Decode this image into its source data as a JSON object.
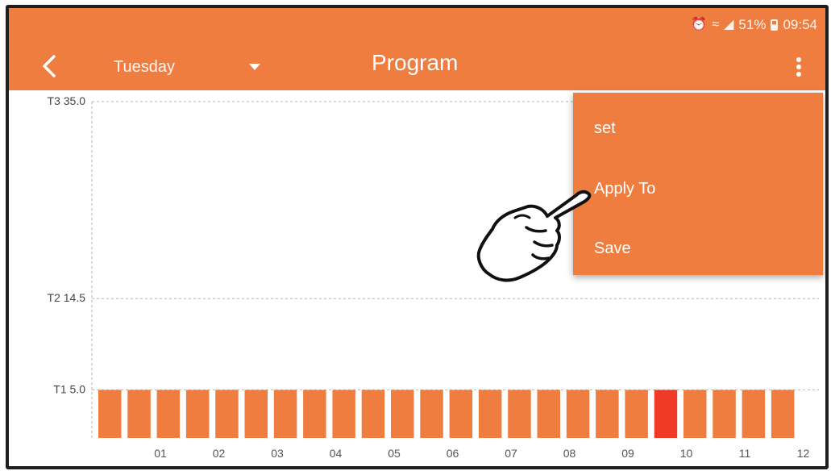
{
  "status": {
    "battery_percent": "51%",
    "time": "09:54",
    "icons": [
      "alarm-icon",
      "wifi-icon",
      "signal-icon",
      "battery-icon"
    ]
  },
  "header": {
    "back_icon": "chevron-left-icon",
    "day": "Tuesday",
    "title": "Program",
    "overflow_icon": "more-vertical-icon"
  },
  "menu": {
    "items": [
      {
        "label": "set"
      },
      {
        "label": "Apply To"
      },
      {
        "label": "Save"
      }
    ]
  },
  "colors": {
    "accent": "#ef7d3f",
    "selected": "#ee3a26",
    "bar": "#ef7d3f"
  },
  "chart_data": {
    "type": "bar",
    "levels": [
      {
        "label": "T3 35.0",
        "value": 35.0
      },
      {
        "label": "T2 14.5",
        "value": 14.5
      },
      {
        "label": "T1 5.0",
        "value": 5.0
      }
    ],
    "hour_labels": [
      "01",
      "02",
      "03",
      "04",
      "05",
      "06",
      "07",
      "08",
      "09",
      "10",
      "11",
      "12"
    ],
    "slot_values": [
      5.0,
      5.0,
      5.0,
      5.0,
      5.0,
      5.0,
      5.0,
      5.0,
      5.0,
      5.0,
      5.0,
      5.0,
      5.0,
      5.0,
      5.0,
      5.0,
      5.0,
      5.0,
      5.0,
      5.0,
      5.0,
      5.0,
      5.0,
      5.0
    ],
    "selected_slot": 19,
    "visible_slots": 24,
    "ylim": [
      0,
      35.0
    ]
  }
}
